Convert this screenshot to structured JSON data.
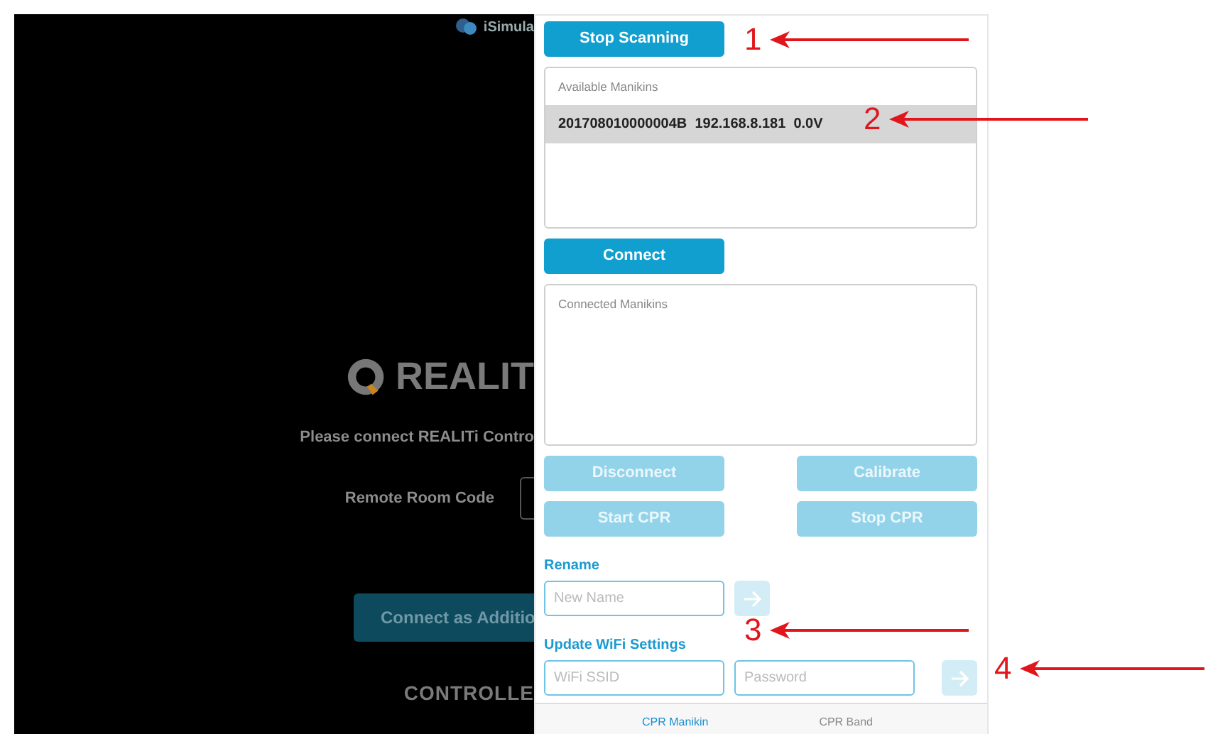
{
  "background_screen": {
    "brand_label": "iSimula",
    "logo_text": "REALIT",
    "prompt": "Please connect REALITi Contro",
    "room_code_label": "Remote Room Code",
    "connect_button": "Connect as Additio",
    "footer_heading": "CONTROLLE"
  },
  "panel": {
    "scan_button": "Stop Scanning",
    "available_list": {
      "title": "Available Manikins",
      "items": [
        {
          "text": "201708010000004B  192.168.8.181  0.0V",
          "selected": true
        }
      ]
    },
    "connect_button": "Connect",
    "connected_list": {
      "title": "Connected Manikins"
    },
    "action_buttons": [
      {
        "label": "Disconnect",
        "disabled": true
      },
      {
        "label": "Calibrate",
        "disabled": true
      },
      {
        "label": "Start CPR",
        "disabled": true
      },
      {
        "label": "Stop CPR",
        "disabled": true
      }
    ],
    "rename": {
      "heading": "Rename",
      "placeholder": "New Name",
      "submit_disabled": true
    },
    "wifi": {
      "heading": "Update WiFi Settings",
      "ssid_placeholder": "WiFi SSID",
      "password_placeholder": "Password",
      "submit_disabled": true
    },
    "tabs": [
      {
        "label": "CPR Manikin",
        "selected": true
      },
      {
        "label": "CPR Band",
        "selected": false
      }
    ]
  },
  "callouts": [
    {
      "number": "1"
    },
    {
      "number": "2"
    },
    {
      "number": "3"
    },
    {
      "number": "4"
    }
  ]
}
